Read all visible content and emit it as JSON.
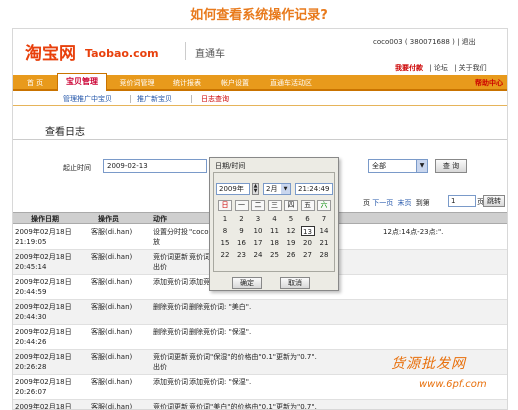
{
  "page_title": "如何查看系统操作记录?",
  "header": {
    "logo_cn": "淘宝网",
    "logo_en": "Taobao.com",
    "product": "直通车",
    "user_info": "coco003 ( 380071688 ) | 退出",
    "links": [
      "我要付款",
      "| 论坛",
      "| 关于我们"
    ]
  },
  "nav": {
    "items": [
      "首 页",
      "宝贝管理",
      "竞价词管理",
      "统计报表",
      "帐户设置",
      "直通车活动区"
    ],
    "active_index": 1,
    "help": "帮助中心"
  },
  "subnav": {
    "items": [
      "管理推广中宝贝",
      "推广新宝贝",
      "日志查询"
    ],
    "active_index": 2
  },
  "section_title": "查看日志",
  "filter": {
    "label": "起止时间",
    "date_value": "2009-02-13",
    "select_value": "全部",
    "query_label": "查 询"
  },
  "pager": {
    "items": [
      "页",
      "下一页",
      "末页",
      "到第"
    ],
    "page_value": "1",
    "page_unit": "页",
    "jump_label": "跳转"
  },
  "table": {
    "columns": [
      "操作日期",
      "操作员",
      "动作"
    ],
    "rows": [
      {
        "date": "2009年02月18日 21:19:05",
        "operator": "客服(di.han)",
        "action": "设置分时投放",
        "desc": "\"coco\"",
        "desc_right": "12点:14点-23点:\"."
      },
      {
        "date": "2009年02月18日 20:45:14",
        "operator": "客服(di.han)",
        "action": "竞价词更新出价",
        "desc": "竞价词"
      },
      {
        "date": "2009年02月18日 20:44:59",
        "operator": "客服(di.han)",
        "action": "添加竞价词",
        "desc": "添加竞"
      },
      {
        "date": "2009年02月18日 20:44:30",
        "operator": "客服(di.han)",
        "action": "删除竞价词",
        "desc": "删除竞价词: \"美白\"."
      },
      {
        "date": "2009年02月18日 20:44:26",
        "operator": "客服(di.han)",
        "action": "删除竞价词",
        "desc": "删除竞价词: \"保湿\"."
      },
      {
        "date": "2009年02月18日 20:26:28",
        "operator": "客服(di.han)",
        "action": "竞价词更新出价",
        "desc": "竞价词\"保湿\"的价格由\"0.1\"更新为\"0.7\"."
      },
      {
        "date": "2009年02月18日 20:26:07",
        "operator": "客服(di.han)",
        "action": "添加竞价词",
        "desc": "添加竞价词: \"保湿\"."
      },
      {
        "date": "2009年02月18日 20:09:14",
        "operator": "客服(di.han)",
        "action": "竞价词更新出价",
        "desc": "竞价词\"美白\"的价格由\"0.1\"更新为\"0.7\"."
      }
    ]
  },
  "datepicker": {
    "title": "日期/时间",
    "year": "2009年",
    "month": "2月",
    "time": "21:24:49",
    "weekdays": [
      "日",
      "一",
      "二",
      "三",
      "四",
      "五",
      "六"
    ],
    "weekday_colors": [
      "#cc0000",
      "#222222",
      "#222222",
      "#222222",
      "#222222",
      "#222222",
      "#008800"
    ],
    "weeks": [
      [
        "1",
        "2",
        "3",
        "4",
        "5",
        "6",
        "7"
      ],
      [
        "8",
        "9",
        "10",
        "11",
        "12",
        "13",
        "14"
      ],
      [
        "15",
        "16",
        "17",
        "18",
        "19",
        "20",
        "21"
      ],
      [
        "22",
        "23",
        "24",
        "25",
        "26",
        "27",
        "28"
      ]
    ],
    "selected_day": "13",
    "ok_label": "确定",
    "cancel_label": "取消"
  },
  "watermark": {
    "line1": "货源批发网",
    "line2": "www.6pf.com"
  },
  "colors": {
    "title_orange": "#e87a1c",
    "nav_orange": "#e89a1c",
    "logo_red": "#e8400c",
    "link_blue": "#2255aa"
  }
}
